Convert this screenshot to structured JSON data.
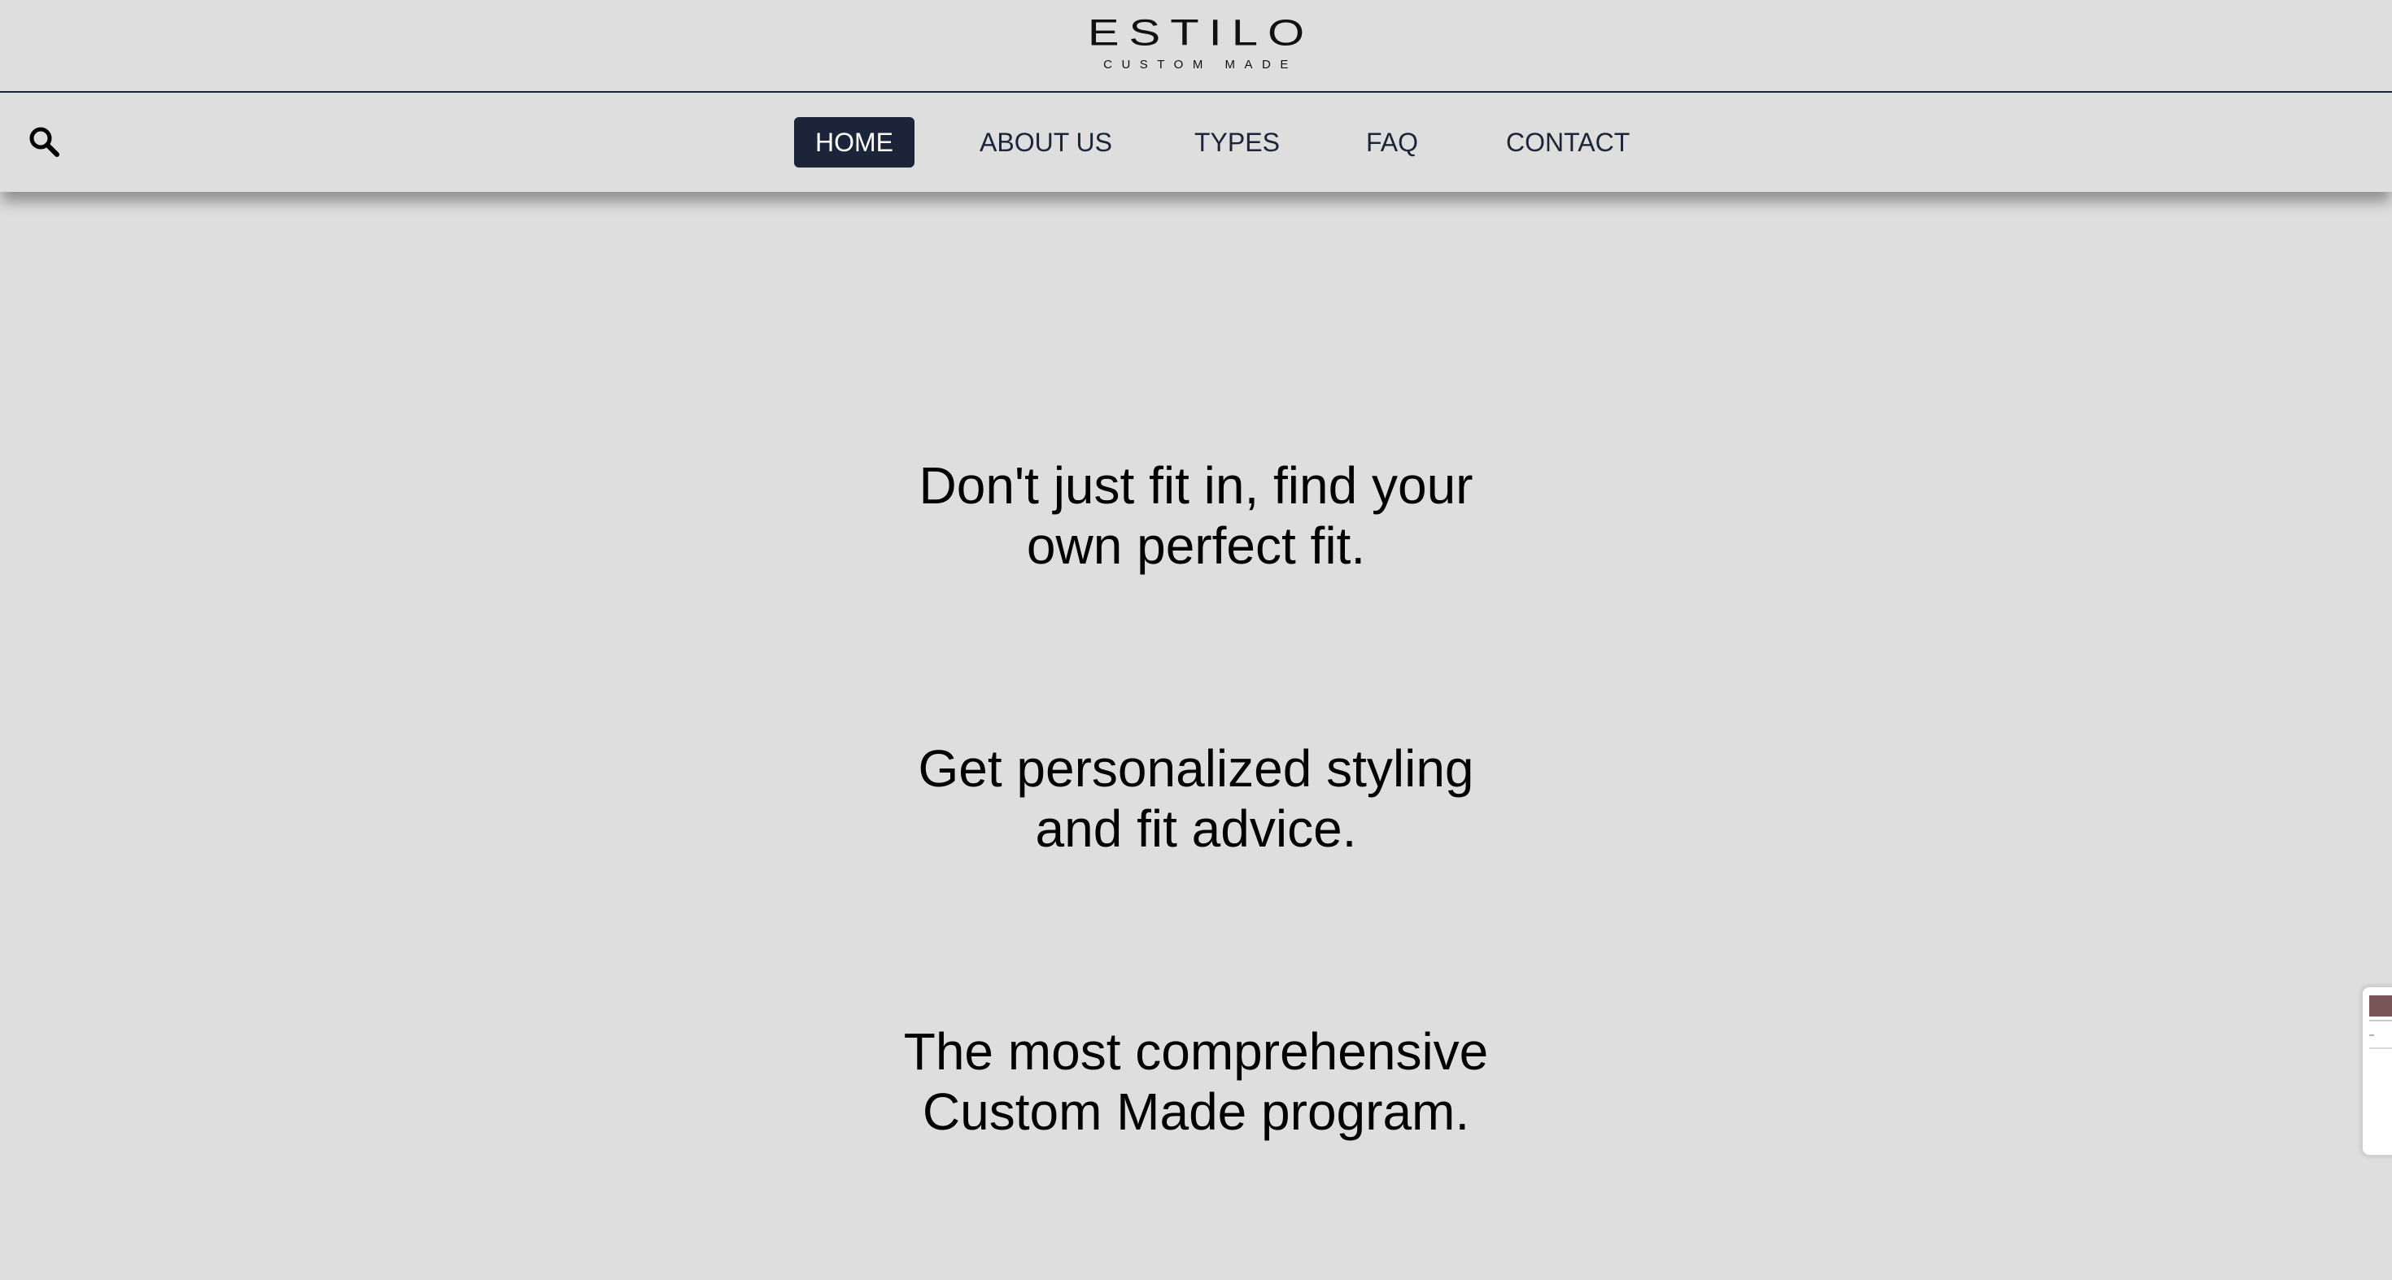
{
  "header": {
    "logo": {
      "wordmark": "ESTILO",
      "tagline": "CUSTOM MADE"
    }
  },
  "nav": {
    "search_icon": "search-icon",
    "items": [
      {
        "label": "HOME",
        "active": true
      },
      {
        "label": "ABOUT US",
        "active": false
      },
      {
        "label": "TYPES",
        "active": false
      },
      {
        "label": "FAQ",
        "active": false
      },
      {
        "label": "CONTACT",
        "active": false
      }
    ]
  },
  "hero": {
    "taglines": [
      {
        "line1": "Don't just fit in, find your",
        "line2": "own perfect fit."
      },
      {
        "line1": "Get personalized styling",
        "line2": "and fit advice."
      },
      {
        "line1": "The most comprehensive",
        "line2": "Custom Made program."
      }
    ]
  },
  "colors": {
    "background": "#dedede",
    "accent": "#1b2438",
    "active_text": "#ffffff",
    "text": "#000000"
  }
}
